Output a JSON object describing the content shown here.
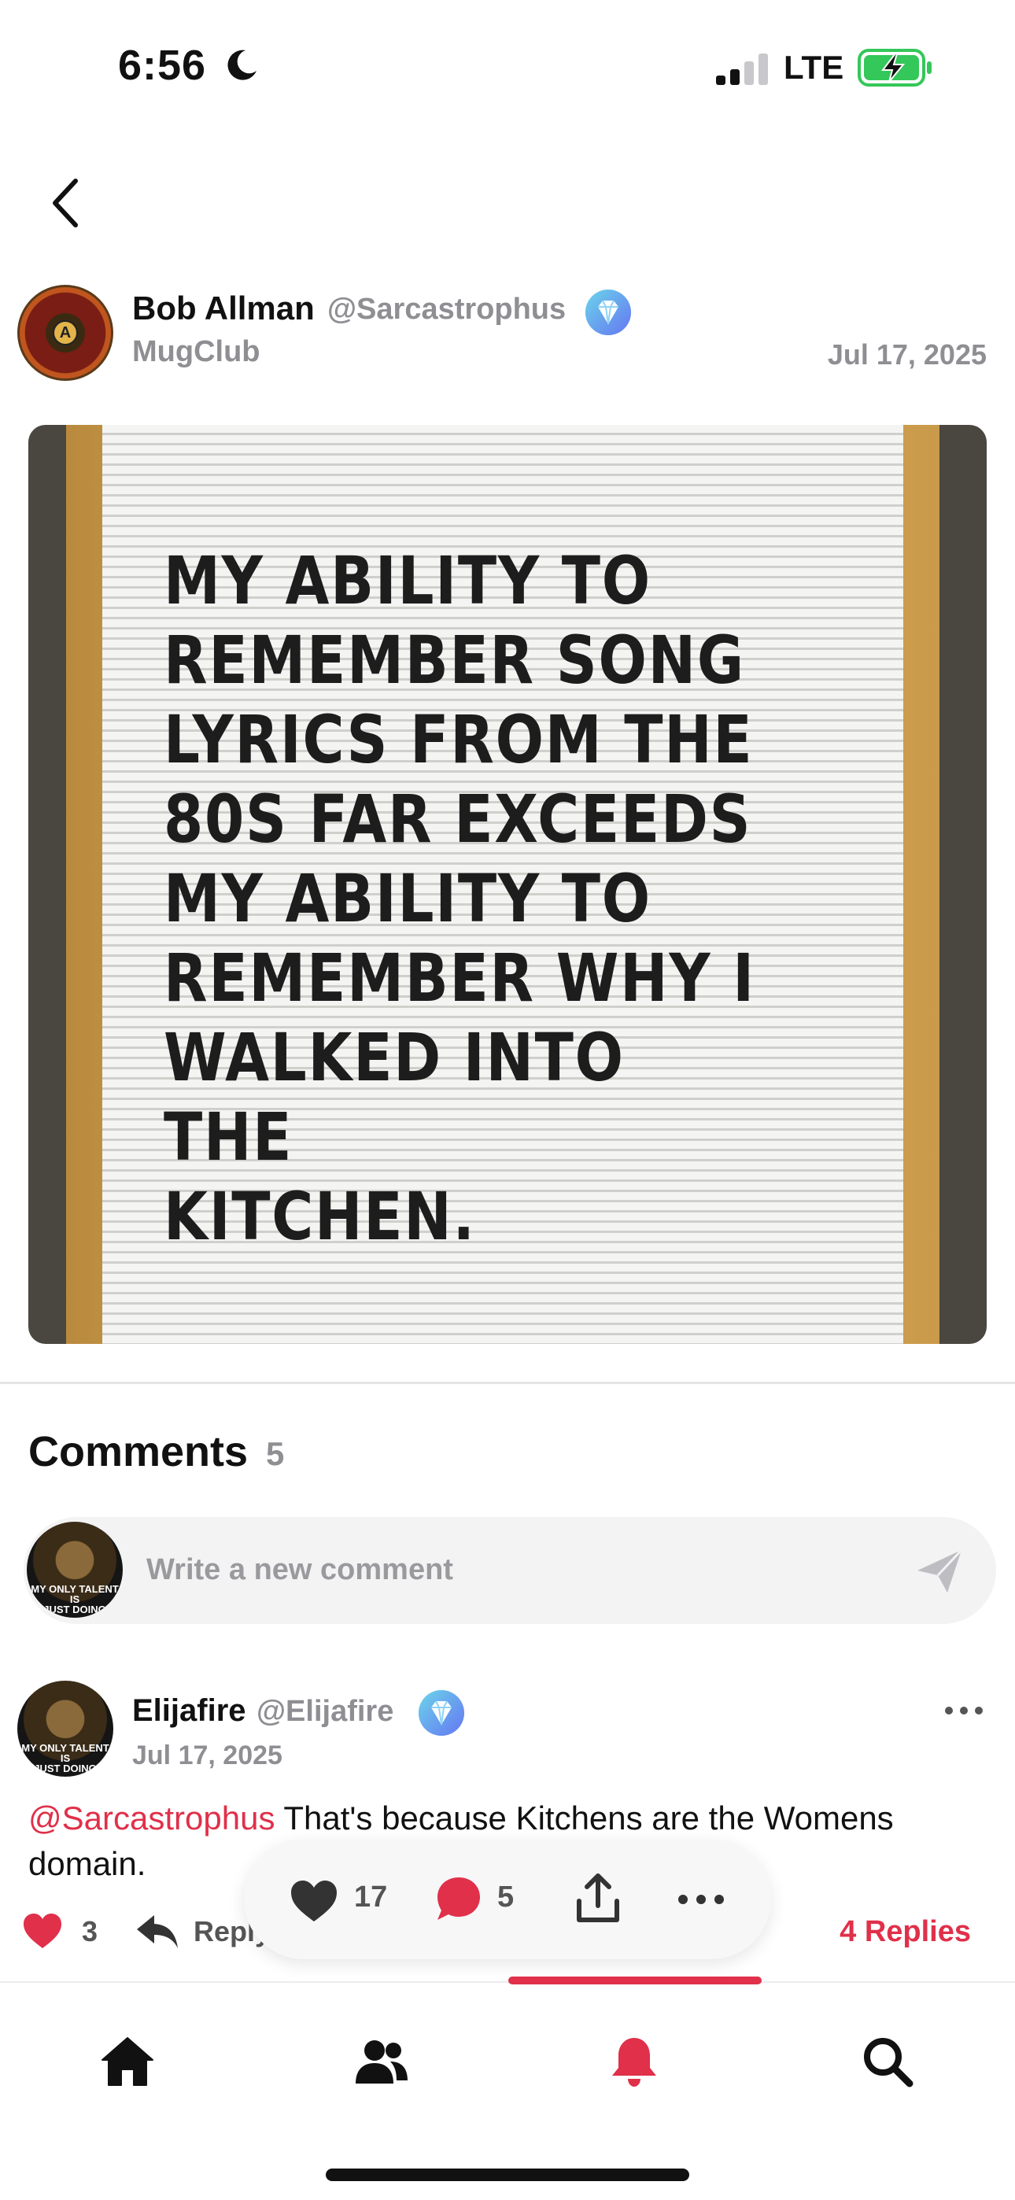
{
  "status_bar": {
    "time": "6:56",
    "network": "LTE",
    "battery_charging": true,
    "battery_color": "#34c759"
  },
  "nav": {
    "back_icon": "chevron-left-icon"
  },
  "post": {
    "author_name": "Bob Allman",
    "author_handle": "@Sarcastrophus",
    "group": "MugClub",
    "date": "Jul 17, 2025",
    "author_avatar_text": "A",
    "image_text": "MY  ABILITY  TO\nREMEMBER  SONG\nLYRICS  FROM  THE\n80S  FAR  EXCEEDS\nMY  ABILITY  TO\nREMEMBER  WHY I\nWALKED  INTO  THE\nKITCHEN."
  },
  "comments": {
    "title": "Comments",
    "count": "5",
    "input_placeholder": "Write a new comment",
    "items": [
      {
        "name": "Elijafire",
        "handle": "@Elijafire",
        "date": "Jul 17, 2025",
        "mention": "@Sarcastrophus",
        "text": " That's because Kitchens are the Womens domain.",
        "likes": "3",
        "reply_label": "Reply",
        "replies_label": "4 Replies",
        "avatar_caption": "MY ONLY TALENT IS\nJUST DOING"
      }
    ]
  },
  "action_bar": {
    "likes": "17",
    "comments": "5"
  },
  "tabs": [
    {
      "name": "home",
      "icon": "home-icon"
    },
    {
      "name": "people",
      "icon": "people-icon"
    },
    {
      "name": "notifications",
      "icon": "bell-icon",
      "active": true
    },
    {
      "name": "search",
      "icon": "search-icon"
    }
  ],
  "colors": {
    "accent": "#e0304a",
    "muted": "#8e8e93",
    "badge": "#5bb8f5"
  }
}
